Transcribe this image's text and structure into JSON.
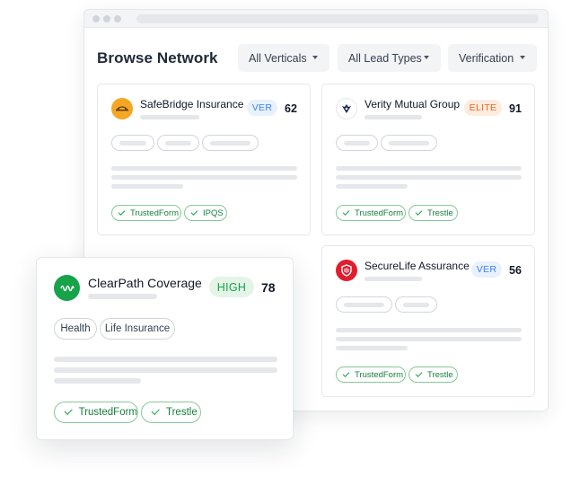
{
  "page": {
    "title": "Browse Network"
  },
  "filters": [
    {
      "label": "All Verticals"
    },
    {
      "label": "All Lead Types"
    },
    {
      "label": "Verification"
    }
  ],
  "cards": [
    {
      "name": "SafeBridge Insurance",
      "badge": "VER",
      "score": "62",
      "tags": [
        "TrustedForm",
        "IPQS"
      ],
      "logo_icon": "shield-bridge-logo",
      "logo_color": "#f5a623"
    },
    {
      "name": "Verity Mutual Group",
      "badge": "ELITE",
      "score": "91",
      "tags": [
        "TrustedForm",
        "Trestle"
      ],
      "logo_icon": "eagle-logo",
      "logo_color": "#1e2a4a"
    },
    {
      "name": "SecureLife Assurance",
      "badge": "VER",
      "score": "56",
      "tags": [
        "TrustedForm",
        "Trestle"
      ],
      "logo_icon": "shield-logo",
      "logo_color": "#e11d2e"
    }
  ],
  "featured": {
    "name": "ClearPath Coverage",
    "badge": "HIGH",
    "score": "78",
    "topics": [
      "Health",
      "Life Insurance"
    ],
    "tags": [
      "TrustedForm",
      "Trestle"
    ],
    "logo_icon": "wave-logo",
    "logo_color": "#16a34a"
  },
  "colors": {
    "ver_badge_bg": "#e8f1fd",
    "ver_badge_text": "#3b82f6",
    "elite_badge_bg": "#fdebe0",
    "elite_badge_text": "#ea6a1f",
    "high_badge_bg": "#e4f5e8",
    "high_badge_text": "#16a34a",
    "verified_green": "#15803d"
  }
}
